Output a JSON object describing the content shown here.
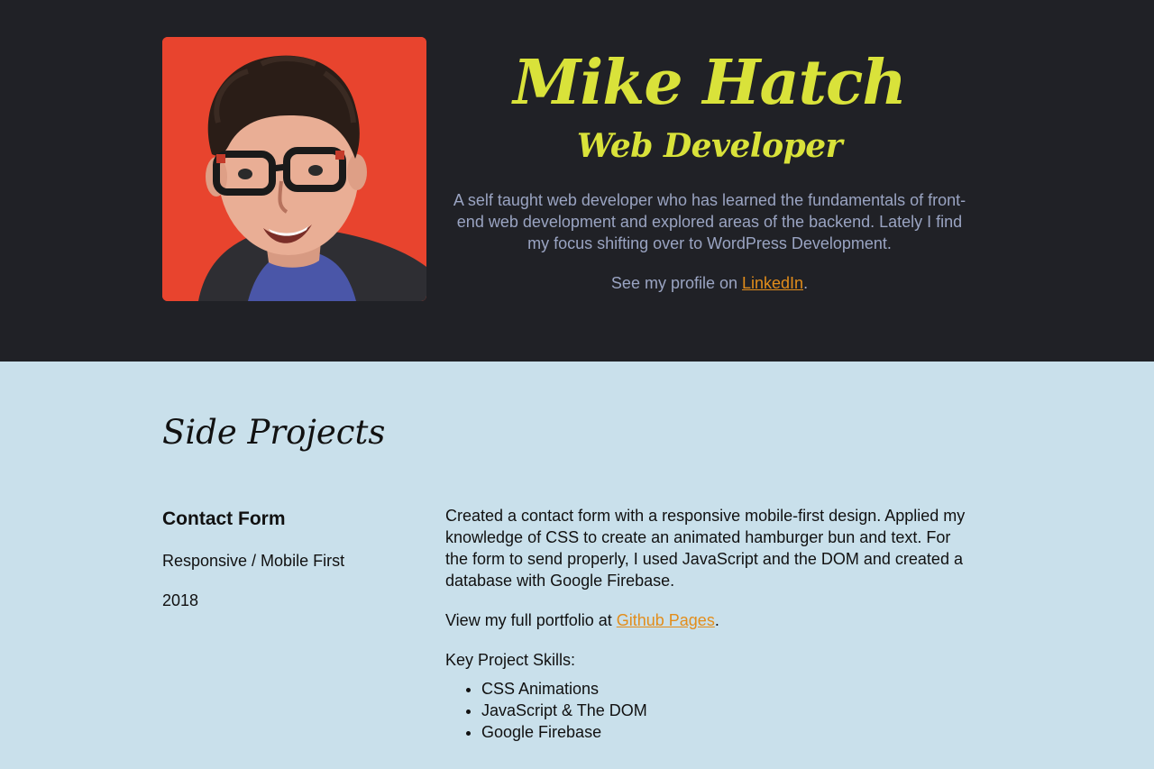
{
  "header": {
    "name": "Mike Hatch",
    "role": "Web Developer",
    "bio": "A self taught web developer who has learned the fundamentals of front-end web development and explored areas of the backend. Lately I find my focus shifting over to WordPress Development.",
    "profile_prefix": "See my profile on ",
    "profile_link": "LinkedIn",
    "profile_suffix": ".",
    "photo_icon": "portrait-photo"
  },
  "projects": {
    "title": "Side Projects",
    "items": [
      {
        "name": "Contact Form",
        "tags": "Responsive / Mobile First",
        "year": "2018",
        "description": "Created a contact form with a responsive mobile-first design. Applied my knowledge of CSS to create an animated hamburger bun and text. For the form to send properly, I used JavaScript and the DOM and created a database with Google Firebase.",
        "portfolio_prefix": "View my full portfolio at ",
        "portfolio_link": "Github Pages",
        "portfolio_suffix": ".",
        "skills_label": "Key Project Skills:",
        "skills": [
          "CSS Animations",
          "JavaScript & The DOM",
          "Google Firebase"
        ]
      }
    ]
  },
  "colors": {
    "hero_bg": "#202126",
    "accent": "#d9e23a",
    "body_text": "#9aa4c2",
    "link": "#e28d1b",
    "section_bg": "#c9e0eb"
  }
}
